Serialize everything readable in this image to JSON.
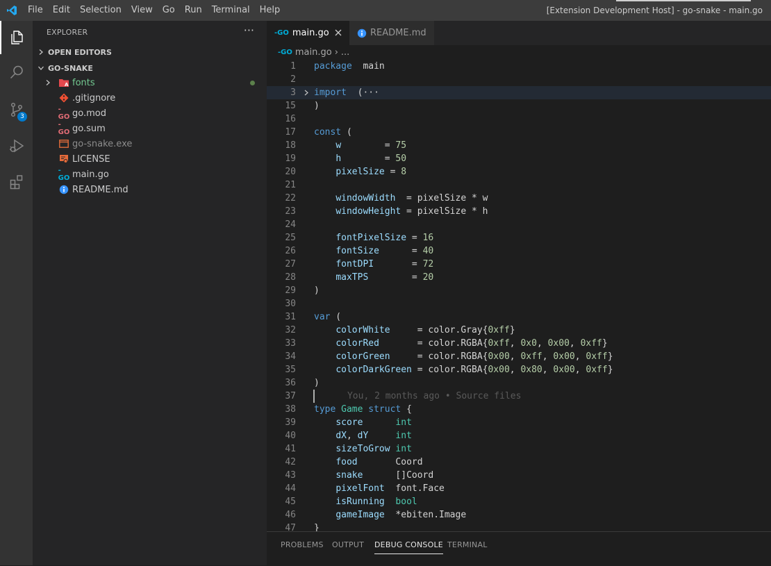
{
  "window": {
    "title": "[Extension Development Host] - go-snake - main.go",
    "menu": [
      "File",
      "Edit",
      "Selection",
      "View",
      "Go",
      "Run",
      "Terminal",
      "Help"
    ]
  },
  "activity_bar": {
    "items": [
      "explorer-icon",
      "search-icon",
      "source-control-icon",
      "run-debug-icon",
      "extensions-icon"
    ],
    "scm_badge": "3",
    "active": "explorer-icon"
  },
  "sidebar": {
    "header": "EXPLORER",
    "more": "···",
    "open_editors": "OPEN EDITORS",
    "workspace": "GO-SNAKE",
    "items": [
      {
        "label": "fonts",
        "icon": "folder-icon",
        "color": "#73c991",
        "modified": true
      },
      {
        "label": ".gitignore",
        "icon": "git-icon",
        "color": "#cccccc"
      },
      {
        "label": "go.mod",
        "icon": "go-mod-icon",
        "color": "#cccccc"
      },
      {
        "label": "go.sum",
        "icon": "go-sum-icon",
        "color": "#cccccc"
      },
      {
        "label": "go-snake.exe",
        "icon": "exe-icon",
        "color": "#8c8c8c"
      },
      {
        "label": "LICENSE",
        "icon": "license-icon",
        "color": "#cccccc"
      },
      {
        "label": "main.go",
        "icon": "go-file-icon",
        "color": "#cccccc"
      },
      {
        "label": "README.md",
        "icon": "info-icon",
        "color": "#cccccc"
      }
    ]
  },
  "tabs": [
    {
      "label": "main.go",
      "active": true
    },
    {
      "label": "README.md",
      "active": false
    }
  ],
  "breadcrumb": {
    "file": "main.go",
    "sep": "›",
    "tail": "..."
  },
  "editor": {
    "lines": [
      {
        "n": "1",
        "t": [
          [
            "kw",
            "package"
          ],
          [
            "",
            "  main"
          ]
        ]
      },
      {
        "n": "2",
        "t": []
      },
      {
        "n": "3",
        "t": [
          [
            "kw",
            "import"
          ],
          [
            "",
            "  ("
          ],
          [
            "fold-ph",
            "···"
          ]
        ],
        "folded": true,
        "hl": true
      },
      {
        "n": "15",
        "t": [
          [
            "",
            ")"
          ]
        ]
      },
      {
        "n": "16",
        "t": []
      },
      {
        "n": "17",
        "t": [
          [
            "kw",
            "const"
          ],
          [
            "",
            " ("
          ]
        ]
      },
      {
        "n": "18",
        "t": [
          [
            "",
            "    "
          ],
          [
            "var",
            "w"
          ],
          [
            "",
            " "
          ],
          [
            "",
            "       = "
          ],
          [
            "num",
            "75"
          ]
        ]
      },
      {
        "n": "19",
        "t": [
          [
            "",
            "    "
          ],
          [
            "var",
            "h"
          ],
          [
            "",
            "        = "
          ],
          [
            "num",
            "50"
          ]
        ]
      },
      {
        "n": "20",
        "t": [
          [
            "",
            "    "
          ],
          [
            "var",
            "pixelSize"
          ],
          [
            "",
            " = "
          ],
          [
            "num",
            "8"
          ]
        ]
      },
      {
        "n": "21",
        "t": []
      },
      {
        "n": "22",
        "t": [
          [
            "",
            "    "
          ],
          [
            "var",
            "windowWidth"
          ],
          [
            "",
            "  = pixelSize * w"
          ]
        ]
      },
      {
        "n": "23",
        "t": [
          [
            "",
            "    "
          ],
          [
            "var",
            "windowHeight"
          ],
          [
            "",
            " = pixelSize * h"
          ]
        ]
      },
      {
        "n": "24",
        "t": []
      },
      {
        "n": "25",
        "t": [
          [
            "",
            "    "
          ],
          [
            "var",
            "fontPixelSize"
          ],
          [
            "",
            " = "
          ],
          [
            "num",
            "16"
          ]
        ]
      },
      {
        "n": "26",
        "t": [
          [
            "",
            "    "
          ],
          [
            "var",
            "fontSize"
          ],
          [
            "",
            "      = "
          ],
          [
            "num",
            "40"
          ]
        ]
      },
      {
        "n": "27",
        "t": [
          [
            "",
            "    "
          ],
          [
            "var",
            "fontDPI"
          ],
          [
            "",
            "       = "
          ],
          [
            "num",
            "72"
          ]
        ]
      },
      {
        "n": "28",
        "t": [
          [
            "",
            "    "
          ],
          [
            "var",
            "maxTPS"
          ],
          [
            "",
            "        = "
          ],
          [
            "num",
            "20"
          ]
        ]
      },
      {
        "n": "29",
        "t": [
          [
            "",
            ")"
          ]
        ]
      },
      {
        "n": "30",
        "t": []
      },
      {
        "n": "31",
        "t": [
          [
            "kw",
            "var"
          ],
          [
            "",
            " ("
          ]
        ]
      },
      {
        "n": "32",
        "t": [
          [
            "",
            "    "
          ],
          [
            "var",
            "colorWhite"
          ],
          [
            "",
            "     = color.Gray{"
          ],
          [
            "num",
            "0xff"
          ],
          [
            "",
            "}"
          ]
        ]
      },
      {
        "n": "33",
        "t": [
          [
            "",
            "    "
          ],
          [
            "var",
            "colorRed"
          ],
          [
            "",
            "       = color.RGBA{"
          ],
          [
            "num",
            "0xff"
          ],
          [
            "",
            ", "
          ],
          [
            "num",
            "0x0"
          ],
          [
            "",
            ", "
          ],
          [
            "num",
            "0x00"
          ],
          [
            "",
            ", "
          ],
          [
            "num",
            "0xff"
          ],
          [
            "",
            "}"
          ]
        ]
      },
      {
        "n": "34",
        "t": [
          [
            "",
            "    "
          ],
          [
            "var",
            "colorGreen"
          ],
          [
            "",
            "     = color.RGBA{"
          ],
          [
            "num",
            "0x00"
          ],
          [
            "",
            ", "
          ],
          [
            "num",
            "0xff"
          ],
          [
            "",
            ", "
          ],
          [
            "num",
            "0x00"
          ],
          [
            "",
            ", "
          ],
          [
            "num",
            "0xff"
          ],
          [
            "",
            "}"
          ]
        ]
      },
      {
        "n": "35",
        "t": [
          [
            "",
            "    "
          ],
          [
            "var",
            "colorDarkGreen"
          ],
          [
            "",
            " = color.RGBA{"
          ],
          [
            "num",
            "0x00"
          ],
          [
            "",
            ", "
          ],
          [
            "num",
            "0x80"
          ],
          [
            "",
            ", "
          ],
          [
            "num",
            "0x00"
          ],
          [
            "",
            ", "
          ],
          [
            "num",
            "0xff"
          ],
          [
            "",
            "}"
          ]
        ]
      },
      {
        "n": "36",
        "t": [
          [
            "",
            ")"
          ]
        ]
      },
      {
        "n": "37",
        "t": [
          [
            "blame",
            "      You, 2 months ago • Source files"
          ]
        ],
        "cursor": true
      },
      {
        "n": "38",
        "t": [
          [
            "kw",
            "type"
          ],
          [
            "",
            " "
          ],
          [
            "ty",
            "Game"
          ],
          [
            "",
            " "
          ],
          [
            "kw",
            "struct"
          ],
          [
            "",
            " {"
          ]
        ]
      },
      {
        "n": "39",
        "t": [
          [
            "",
            "    "
          ],
          [
            "var",
            "score"
          ],
          [
            "",
            "      "
          ],
          [
            "ty",
            "int"
          ]
        ]
      },
      {
        "n": "40",
        "t": [
          [
            "",
            "    "
          ],
          [
            "var",
            "dX"
          ],
          [
            "",
            ", "
          ],
          [
            "var",
            "dY"
          ],
          [
            "",
            "     "
          ],
          [
            "ty",
            "int"
          ]
        ]
      },
      {
        "n": "41",
        "t": [
          [
            "",
            "    "
          ],
          [
            "var",
            "sizeToGrow"
          ],
          [
            "",
            " "
          ],
          [
            "ty",
            "int"
          ]
        ]
      },
      {
        "n": "42",
        "t": [
          [
            "",
            "    "
          ],
          [
            "var",
            "food"
          ],
          [
            "",
            "       Coord"
          ]
        ]
      },
      {
        "n": "43",
        "t": [
          [
            "",
            "    "
          ],
          [
            "var",
            "snake"
          ],
          [
            "",
            "      []Coord"
          ]
        ]
      },
      {
        "n": "44",
        "t": [
          [
            "",
            "    "
          ],
          [
            "var",
            "pixelFont"
          ],
          [
            "",
            "  font.Face"
          ]
        ]
      },
      {
        "n": "45",
        "t": [
          [
            "",
            "    "
          ],
          [
            "var",
            "isRunning"
          ],
          [
            "",
            "  "
          ],
          [
            "ty",
            "bool"
          ]
        ]
      },
      {
        "n": "46",
        "t": [
          [
            "",
            "    "
          ],
          [
            "var",
            "gameImage"
          ],
          [
            "",
            "  *ebiten.Image"
          ]
        ]
      },
      {
        "n": "47",
        "t": [
          [
            "",
            "}"
          ]
        ]
      }
    ]
  },
  "panel": {
    "tabs": [
      "PROBLEMS",
      "OUTPUT",
      "DEBUG CONSOLE",
      "TERMINAL"
    ],
    "active": "DEBUG CONSOLE"
  },
  "colors": {
    "accent": "#007acc",
    "keyword": "#569cd6",
    "type": "#4ec9b0",
    "number": "#b5cea8",
    "variable": "#9cdcfe",
    "go": "#00add8"
  }
}
